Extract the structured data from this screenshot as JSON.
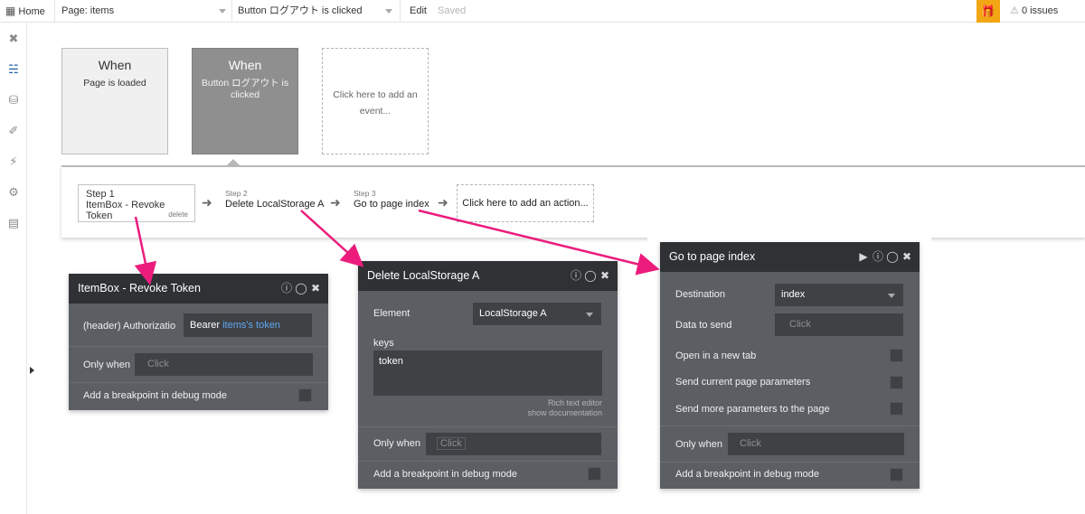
{
  "topbar": {
    "home": "Home",
    "page": "Page: items",
    "workflow": "Button ログアウト is clicked",
    "edit": "Edit",
    "saved": "Saved",
    "issues": "0 issues"
  },
  "sidebar": {
    "icons": [
      "design-icon",
      "workflow-icon",
      "data-icon",
      "styles-icon",
      "plugins-icon",
      "settings-icon",
      "logs-icon"
    ],
    "active": "workflow-icon"
  },
  "events": [
    {
      "when": "When",
      "text": "Page is loaded"
    },
    {
      "when": "When",
      "text": "Button ログアウト is clicked"
    },
    {
      "text": "Click here to add an event..."
    }
  ],
  "steps": [
    {
      "label": "Step 1",
      "name": "ItemBox - Revoke Token",
      "delete": "delete"
    },
    {
      "label": "Step 2",
      "name": "Delete LocalStorage A"
    },
    {
      "label": "Step 3",
      "name": "Go to page index"
    }
  ],
  "add_action": "Click here to add an action...",
  "panel1": {
    "title": "ItemBox - Revoke Token",
    "header_label": "(header) Authorizatio",
    "header_value_prefix": "Bearer ",
    "header_value_dynamic": "items's token",
    "only_when_label": "Only when",
    "only_when_placeholder": "Click",
    "breakpoint_label": "Add a breakpoint in debug mode"
  },
  "panel2": {
    "title": "Delete LocalStorage A",
    "element_label": "Element",
    "element_value": "LocalStorage A",
    "keys_label": "keys",
    "keys_value": "token",
    "rich_text": "Rich text editor",
    "show_doc": "show documentation",
    "only_when_label": "Only when",
    "only_when_placeholder": "Click",
    "breakpoint_label": "Add a breakpoint in debug mode"
  },
  "panel3": {
    "title": "Go to page index",
    "destination_label": "Destination",
    "destination_value": "index",
    "data_label": "Data to send",
    "data_placeholder": "Click",
    "new_tab_label": "Open in a new tab",
    "send_params_label": "Send current page parameters",
    "more_params_label": "Send more parameters to the page",
    "only_when_label": "Only when",
    "only_when_placeholder": "Click",
    "breakpoint_label": "Add a breakpoint in debug mode"
  },
  "colors": {
    "annotation_arrow": "#ec1c7c",
    "accent": "#f3a613",
    "link": "#5fa8ef",
    "panel_bg": "#5b5e63",
    "panel_header": "#2f3134"
  }
}
